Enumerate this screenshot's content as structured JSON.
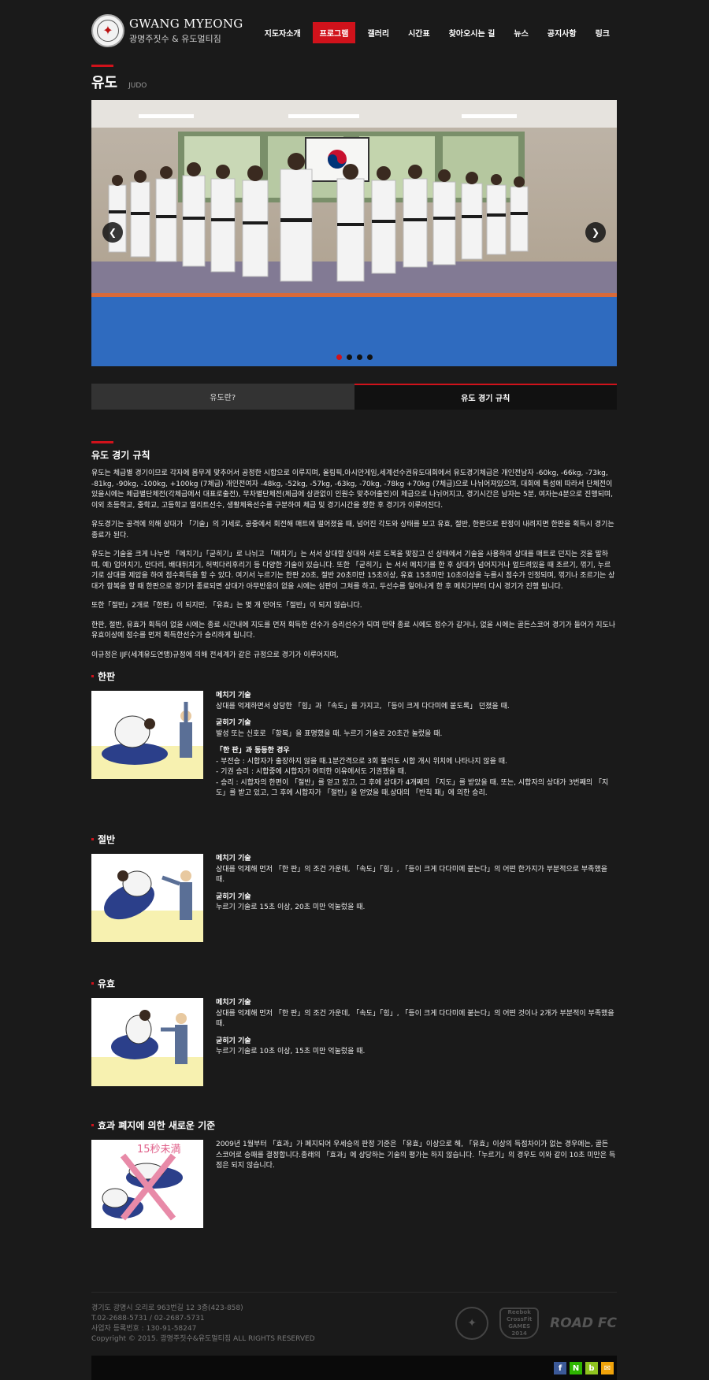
{
  "header": {
    "logo_title": "GWANG MYEONG",
    "logo_subtitle": "광명주짓수 & 유도멀티짐",
    "nav": [
      "지도자소개",
      "프로그램",
      "갤러리",
      "시간표",
      "찾아오시는 길",
      "뉴스",
      "공지사항",
      "링크"
    ],
    "active_nav": "프로그램"
  },
  "page": {
    "title": "유도",
    "subtitle": "JUDO"
  },
  "slider": {
    "prev_icon": "chevron-left-icon",
    "next_icon": "chevron-right-icon",
    "dot_count": 4,
    "active_dot": 1
  },
  "tabs": [
    {
      "label": "유도란?",
      "active": false
    },
    {
      "label": "유도 경기 규칙",
      "active": true
    }
  ],
  "rules": {
    "title": "유도 경기 규칙",
    "paragraphs": [
      "유도는 체급별 경기이므로 각자에 몸무게 맞추어서 공정한 시합으로 이루지며, 올림픽,아시안게임,세계선수권유도대회에서 유도경기체급은 개인전남자 -60kg, -66kg, -73kg, -81kg, -90kg, -100kg, +100kg (7체급) 개인전여자 -48kg, -52kg, -57kg, -63kg, -70kg, -78kg +70kg (7체급)으로 나뉘어져있으며, 대회에 특성에 따라서 단체전이 있을시에는 체급별단체전(각체급에서 대표로출전), 무차별단체전(체급에 상관없이 인원수 맞추어출전)이 체급으로 나뉘어지고, 경기시간은 남자는 5분, 여자는4분으로 진행되며, 이외 초등학교, 중학교, 고등학교 엘리트선수, 생활체육선수를 구분하여 체급 및 경기시간을 정한 후 경기가 이루어진다.",
      "유도경기는 공격에 의해 상대가 「기술」의 기세로, 공중에서 회전해 매트에 떨어졌을 때, 넘어진 각도와 상태를 보고 유효, 절반, 한판으로 판정이 내려지면 한판을 획득시 경기는 종료가 된다.",
      "유도는 기술을 크게 나누면 「메치기」「굳히기」로 나뉘고 「메치기」는 서서 상대할 상대와 서로 도복을 맞잡고 선 상태에서 기술을 사용하여 상대를 매트로 던지는 것을 말하며, 예) 업어치기, 안다리, 배대뒤치기, 허벅다리후리기 등 다양한 기술이 있습니다. 또한 「굳히기」는 서서 메치기를 한 후 상대가 넘어지거나 엎드려있을 때 조르기, 꺾기, 누르기로 상대를 제압을 하여 점수획득을 할 수 있다. 여기서 누르기는 한판 20초, 절반 20초미만 15초이상, 유효 15초미만 10초이상을 누를시 점수가 인정되며, 꺾기나 조르기는 상대가 항복을 할 때 한판으로 경기가 종료되면 상대가 아무반응이 없을 시에는 심판이 그쳐를 하고, 두선수를 일어나게 한 후 메치기부터 다시 경기가 진행 됩니다.",
      "또한「절반」2개로「한판」이 되지만, 「유효」는 몇 개 얻어도「절반」이 되지 않습니다.",
      "한판, 절반, 유효가 획득이 없을 시에는 종료 시간내에 지도를 먼저 획득한 선수가 승리선수가 되며 만약 종료 시에도 점수가 같거나, 없을 시에는 골든스코어 경기가 들어가 지도나 유효이상에 점수를 먼저 획득한선수가 승리하게 됩니다.",
      "이규정은 IJF(세계유도연맹)규정에 의해 전세계가 같은 규정으로 경기가 이루어지며,"
    ]
  },
  "scores": [
    {
      "title": "한판",
      "blocks": [
        {
          "head": "메치기 기술",
          "lines": [
            "상대를 억제하면서 상당한 「힘」과 「속도」를 가지고, 「등이 크게 다다미에 붙도록」 던졌을 때."
          ]
        },
        {
          "head": "굳히기 기술",
          "lines": [
            "발성 또는 신호로 「항복」을 표명했을 때. 누르기 기술로 20초간 눌렀을 때."
          ]
        },
        {
          "head": "「한 판」과 동등한 경우",
          "lines": [
            "- 부전승 : 시합자가 출장하지 않을 때.1분간격으로 3회 불러도 시합 개시 위치에 나타나지 않을 때.",
            "- 기권 승리 : 시합중에 시합자가 어떠한 이유에서도 기권했을 때.",
            "- 승리 : 시합자의 한편이 「절반」를 얻고 있고, 그 후에 상대가 4개째의 「지도」를 받았을 때. 또는, 시합자의 상대가 3번째의 「지도」를 받고 있고, 그 후에 시합자가 「절반」을 얻었을 때.상대의 「반칙 패」에 의한 승리."
          ]
        }
      ]
    },
    {
      "title": "절반",
      "blocks": [
        {
          "head": "메치기 기술",
          "lines": [
            "상대를 억제해 먼저 「한 판」의 조건 가운데, 「속도」「힘」, 「등이 크게 다다미에 붙는다」의 어떤 한가지가 부분적으로 부족했을 때."
          ]
        },
        {
          "head": "굳히기 기술",
          "lines": [
            "누르기 기술로 15초 이상, 20초 미만 억눌렀을 때."
          ]
        }
      ]
    },
    {
      "title": "유효",
      "blocks": [
        {
          "head": "메치기 기술",
          "lines": [
            "상대를 억제해 먼저 「한 판」의 조건 가운데, 「속도」「힘」, 「등이 크게 다다미에 붙는다」의 어떤 것이나 2개가 부분적이 부족했을 때."
          ]
        },
        {
          "head": "굳히기 기술",
          "lines": [
            "누르기 기술로 10초 이상, 15초 미만 억눌렀을 때."
          ]
        }
      ]
    },
    {
      "title": "효과 폐지에 의한 새로운 기준",
      "blocks": [
        {
          "head": "",
          "lines": [
            "2009년 1월부터 「효과」가 폐지되어 우세승의 판정 기준은 「유효」이상으로 해, 「유효」이상의 득점차이가 없는 경우에는, 골든 스코어로 승패를 결정합니다.종래의 「효과」에 상당하는 기술의 평가는 하지 않습니다.「누르기」의 경우도 이와 같이 10초 미만은 득점은 되지 않습니다."
          ]
        }
      ],
      "illus_text": "15秒未満"
    }
  ],
  "footer": {
    "lines": [
      "경기도 광명시 오리로 963번길 12 3층(423-858)",
      "T.02-2688-5731 / 02-2687-5731",
      "사업자 등록번호 : 130-91-58247",
      "Copyright © 2015. 광명주짓수&유도멀티짐 ALL RIGHTS RESERVED"
    ],
    "sponsor_reebok": "Reebok",
    "sponsor_crossfit": "CrossFit GAMES",
    "sponsor_year": "2014",
    "sponsor_road": "ROAD FC",
    "social": [
      {
        "icon": "facebook-icon",
        "glyph": "f",
        "color": "#3b5998"
      },
      {
        "icon": "naver-icon",
        "glyph": "N",
        "color": "#2db400"
      },
      {
        "icon": "blog-icon",
        "glyph": "b",
        "color": "#8fc31f"
      },
      {
        "icon": "mail-icon",
        "glyph": "✉",
        "color": "#f0a30a"
      }
    ]
  }
}
